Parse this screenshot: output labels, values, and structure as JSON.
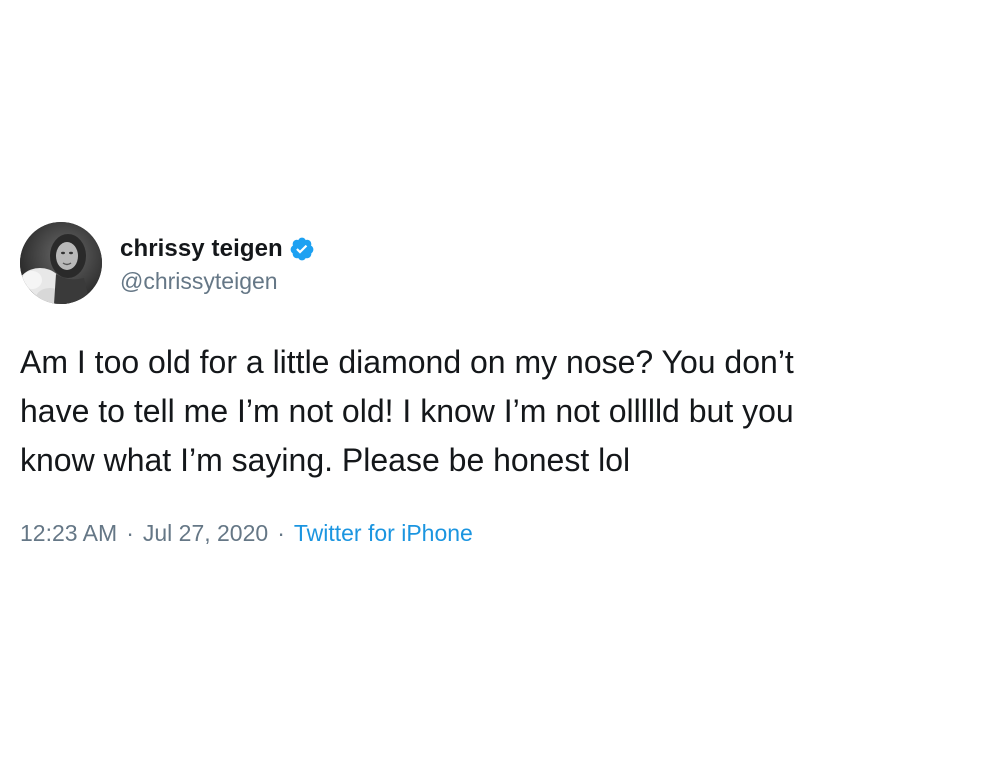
{
  "tweet": {
    "author": {
      "display_name": "chrissy teigen",
      "handle": "@chrissyteigen",
      "verified": true,
      "avatar_icon": "profile-photo"
    },
    "text": "Am I too old for a little diamond on my nose? You don’t\nhave to tell me I’m not old! I know I’m not ollllld but you\nknow what I’m saying. Please be honest lol",
    "time": "12:23 AM",
    "separator": "·",
    "date": "Jul 27, 2020",
    "source": "Twitter for iPhone"
  },
  "colors": {
    "text_primary": "#14171a",
    "text_secondary": "#657786",
    "link_blue": "#1b95e0",
    "verified_blue": "#1da1f2"
  }
}
